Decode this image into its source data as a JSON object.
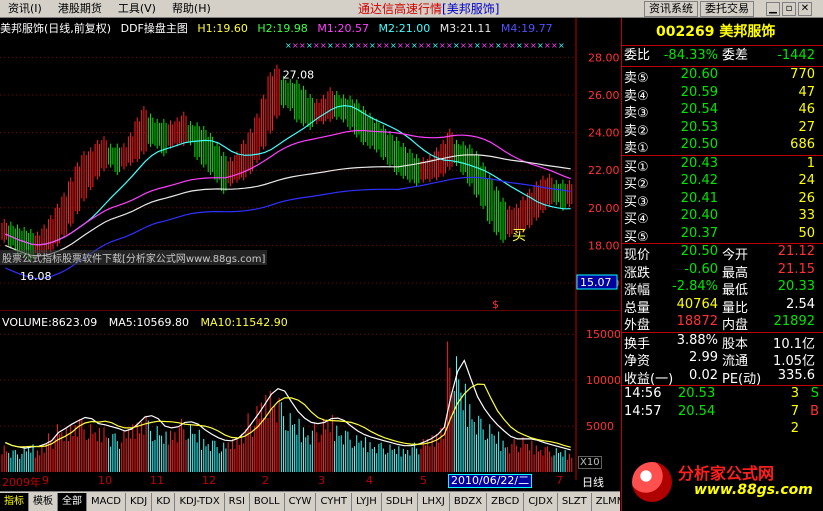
{
  "menu": {
    "items": [
      "资讯(I)",
      "港股期货",
      "工具(V)",
      "帮助(H)"
    ],
    "app_title": "通达信高速行情",
    "app_title_stock": "[美邦服饰]",
    "btn_news": "资讯系统",
    "btn_trade": "委托交易"
  },
  "chart": {
    "header": {
      "name": "美邦服饰(日线,前复权)",
      "indicator": "DDF操盘主图",
      "h1": "H1:19.60",
      "h2": "H2:19.98",
      "m1": "M1:20.57",
      "m2": "M2:21.00",
      "m3": "M3:21.11",
      "m4": "M4:19.77"
    },
    "high_label": "27.08",
    "low_label": "16.08",
    "buy_label": "买",
    "price_cursor": "15.07",
    "watermark": "股票公式指标股票软件下载[分析家公式网www.88gs.com]",
    "colors": {
      "up": "#ff2020",
      "down": "#00e600",
      "ma_white": "#e8e8e8",
      "ma_blue": "#3030ff",
      "ma_cyan": "#40ffff",
      "ma_magenta": "#ff40ff",
      "ma_yellow": "#ffff40",
      "grid": "#800000"
    }
  },
  "chart_data": {
    "type": "bar",
    "title": "美邦服饰(日线,前复权)",
    "price_axis": [
      "28.00",
      "26.00",
      "24.00",
      "22.00",
      "20.00",
      "18.00",
      "16.00"
    ],
    "volume_axis": [
      "15000",
      "10000",
      "5000"
    ],
    "ylim": [
      16,
      28.5
    ],
    "volume_ylim": [
      0,
      16000
    ],
    "close_series": [
      18.6,
      18.3,
      18.0,
      17.8,
      17.6,
      17.9,
      18.3,
      18.8,
      19.4,
      20.0,
      20.8,
      21.6,
      22.2,
      22.4,
      22.8,
      23.0,
      22.6,
      22.2,
      22.5,
      23.2,
      24.0,
      24.6,
      24.2,
      23.6,
      23.2,
      23.6,
      24.0,
      24.3,
      23.8,
      23.0,
      22.6,
      22.2,
      21.8,
      21.2,
      21.6,
      22.2,
      22.8,
      23.4,
      24.2,
      25.2,
      26.4,
      26.8,
      26.2,
      25.6,
      25.0,
      24.8,
      24.6,
      24.9,
      25.2,
      25.6,
      25.4,
      25.0,
      24.6,
      24.2,
      23.8,
      23.6,
      23.4,
      23.0,
      22.6,
      22.2,
      22.0,
      21.8,
      21.6,
      21.8,
      22.0,
      22.4,
      22.8,
      23.4,
      22.8,
      22.2,
      21.6,
      21.0,
      20.4,
      19.6,
      19.0,
      18.6,
      18.9,
      19.4,
      19.8,
      20.2,
      20.6,
      20.9,
      21.0,
      20.6,
      20.3,
      20.5
    ],
    "volume_series": [
      3200,
      2600,
      2400,
      2800,
      3000,
      2600,
      3500,
      4200,
      5200,
      4800,
      5600,
      6400,
      5800,
      5200,
      4800,
      5400,
      4600,
      4200,
      4600,
      5200,
      6000,
      6800,
      5600,
      5000,
      4400,
      5000,
      5400,
      5800,
      5200,
      4600,
      4000,
      3800,
      3400,
      3200,
      3600,
      4200,
      5200,
      6400,
      7200,
      8400,
      9800,
      9000,
      7600,
      6400,
      5800,
      5400,
      5000,
      5400,
      5800,
      6200,
      5600,
      5000,
      4400,
      4000,
      3800,
      3600,
      3400,
      3200,
      3000,
      2800,
      2800,
      3000,
      3200,
      3600,
      4000,
      4600,
      6000,
      14200,
      12600,
      9600,
      8200,
      6800,
      5800,
      5200,
      4400,
      3800,
      3400,
      3600,
      3800,
      3400,
      3200,
      3000,
      2800,
      2600,
      2400,
      2200
    ],
    "volume_ma5_label": "MA5:10569.80",
    "volume_ma10_label": "MA10:11542.90",
    "volume_label": "VOLUME:8623.09",
    "date_labels": [
      "2009年",
      "9",
      "10",
      "11",
      "12",
      "2",
      "3",
      "4",
      "5",
      "6",
      "7"
    ]
  },
  "date_cursor": "2010/06/22/二",
  "x10": "X10",
  "daily_label": "日线",
  "tabs": [
    "指标",
    "模板",
    "全部",
    "MACD",
    "KDJ",
    "KD",
    "KDJ-TDX",
    "RSI",
    "BOLL",
    "CYW",
    "CYHT",
    "LYJH",
    "SDLH",
    "LHXJ",
    "BDZX",
    "ZBCD",
    "CJDX",
    "SLZT",
    "ZLMM"
  ],
  "panel": {
    "code_name": "002269 美邦服饰",
    "weibi": {
      "label": "委比",
      "value": "-84.33%",
      "label2": "委差",
      "value2": "-1442"
    },
    "sell": [
      {
        "label": "卖⑤",
        "price": "20.60",
        "vol": "770"
      },
      {
        "label": "卖④",
        "price": "20.59",
        "vol": "47"
      },
      {
        "label": "卖③",
        "price": "20.54",
        "vol": "46"
      },
      {
        "label": "卖②",
        "price": "20.53",
        "vol": "27"
      },
      {
        "label": "卖①",
        "price": "20.50",
        "vol": "686"
      }
    ],
    "buy": [
      {
        "label": "买①",
        "price": "20.43",
        "vol": "1"
      },
      {
        "label": "买②",
        "price": "20.42",
        "vol": "24"
      },
      {
        "label": "买③",
        "price": "20.41",
        "vol": "26"
      },
      {
        "label": "买④",
        "price": "20.40",
        "vol": "33"
      },
      {
        "label": "买⑤",
        "price": "20.37",
        "vol": "50"
      }
    ],
    "quote": [
      {
        "l1": "现价",
        "v1": "20.50",
        "c1": "green",
        "l2": "今开",
        "v2": "21.12",
        "c2": "red"
      },
      {
        "l1": "涨跌",
        "v1": "-0.60",
        "c1": "green",
        "l2": "最高",
        "v2": "21.15",
        "c2": "red"
      },
      {
        "l1": "涨幅",
        "v1": "-2.84%",
        "c1": "green",
        "l2": "最低",
        "v2": "20.33",
        "c2": "green"
      },
      {
        "l1": "总量",
        "v1": "40764",
        "c1": "yellow",
        "l2": "量比",
        "v2": "2.54",
        "c2": "white"
      },
      {
        "l1": "外盘",
        "v1": "18872",
        "c1": "red",
        "l2": "内盘",
        "v2": "21892",
        "c2": "green"
      }
    ],
    "fin": [
      {
        "l1": "换手",
        "v1": "3.88%",
        "l2": "股本",
        "v2": "10.1亿"
      },
      {
        "l1": "净资",
        "v1": "2.99",
        "l2": "流通",
        "v2": "1.05亿"
      },
      {
        "l1": "收益(一)",
        "v1": "0.02",
        "l2": "PE(动)",
        "v2": "335.6"
      }
    ],
    "trades": [
      {
        "time": "14:56",
        "price": "20.53",
        "qty": "3",
        "flag": "S",
        "flag_color": "green"
      },
      {
        "time": "14:57",
        "price": "20.54",
        "qty": "7",
        "flag": "B",
        "flag_color": "red"
      },
      {
        "time": "",
        "price": "",
        "qty": "2",
        "flag": "",
        "flag_color": "white"
      }
    ],
    "logo_brand": "分析家公式网",
    "logo_url": "www.88gs.com"
  }
}
